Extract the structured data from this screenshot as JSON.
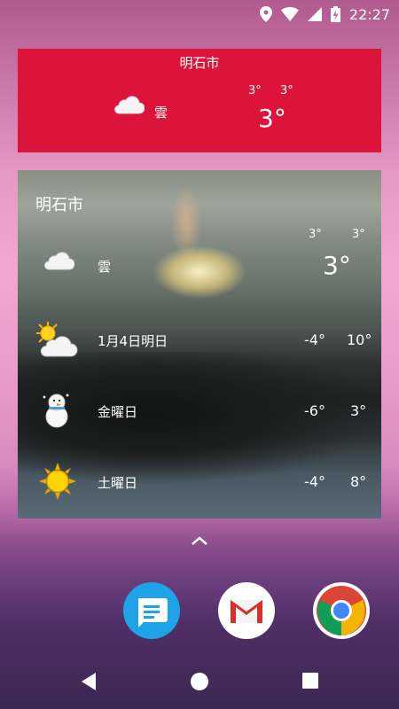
{
  "status": {
    "time": "22:27"
  },
  "small_widget": {
    "city": "明石市",
    "condition": "雲",
    "temp_high": "3°",
    "temp_low": "3°",
    "temp_current": "3°"
  },
  "big_widget": {
    "city": "明石市",
    "current": {
      "condition": "雲",
      "temp_high": "3°",
      "temp_low": "3°",
      "temp_current": "3°"
    },
    "forecast": [
      {
        "label": "1月4日明日",
        "low": "-4°",
        "high": "10°",
        "icon": "sun-cloud-icon"
      },
      {
        "label": "金曜日",
        "low": "-6°",
        "high": "3°",
        "icon": "snowman-icon"
      },
      {
        "label": "土曜日",
        "low": "-4°",
        "high": "8°",
        "icon": "sun-icon"
      }
    ]
  },
  "dock": [
    {
      "name": "messages-app-icon",
      "color": "#1fa3e8"
    },
    {
      "name": "gmail-app-icon",
      "color": "#ffffff"
    },
    {
      "name": "chrome-app-icon",
      "color": "#ffffff"
    }
  ],
  "colors": {
    "small_widget_bg": "#dc143c"
  }
}
